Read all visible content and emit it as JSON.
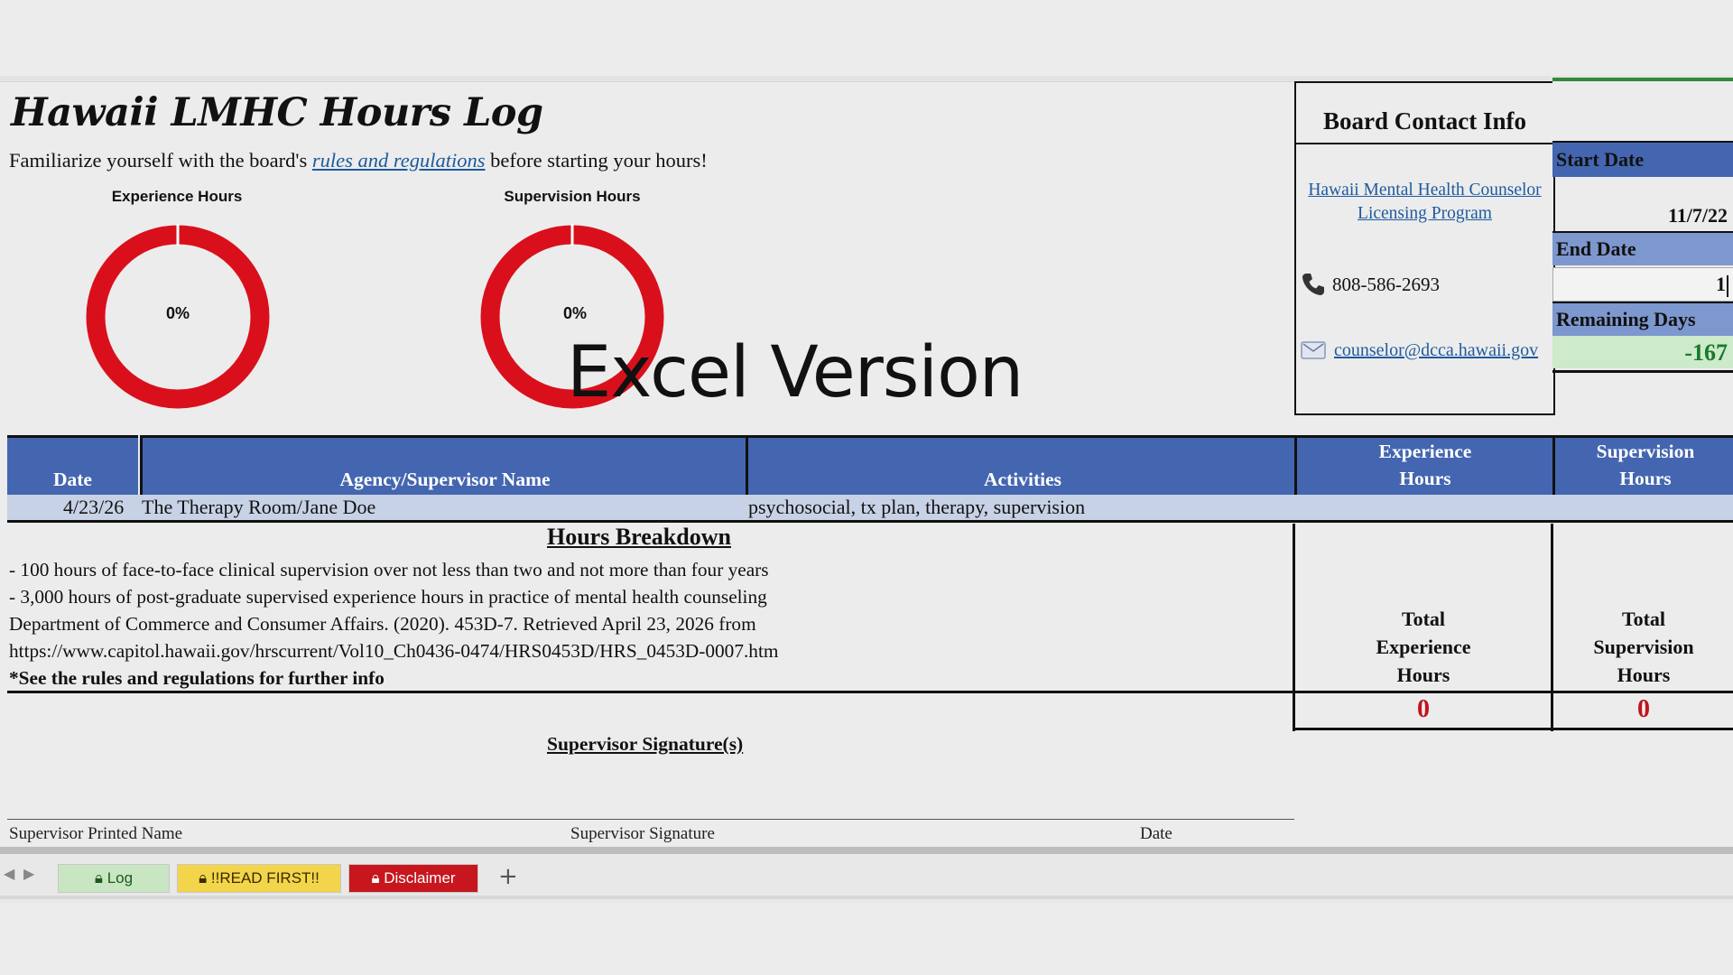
{
  "title": "Hawaii LMHC Hours Log",
  "subtitle": {
    "before": "Familiarize yourself with the board's ",
    "link": "rules and regulations",
    "after": " before starting your hours!"
  },
  "charts": {
    "experience": {
      "title": "Experience Hours",
      "label": "0%",
      "progress": 0,
      "color": "#d9101c"
    },
    "supervision": {
      "title": "Supervision Hours",
      "label": "0%",
      "progress": 0,
      "color": "#d9101c"
    }
  },
  "watermark": "Excel Version",
  "contact": {
    "title": "Board Contact Info",
    "program_link": "Hawaii Mental Health Counselor Licensing Program",
    "phone": "808-586-2693",
    "email": "counselor@dcca.hawaii.gov",
    "phone_icon": "phone-icon",
    "email_icon": "email-icon"
  },
  "dates": {
    "start_label": "Start Date",
    "start_value": "11/7/22",
    "end_label": "End Date",
    "end_value": "1",
    "remaining_label": "Remaining Days",
    "remaining_value": "-167",
    "remaining_color": "#1a7a2a",
    "remaining_bg": "#cdeacb"
  },
  "table": {
    "headers": {
      "date": "Date",
      "agency": "Agency/Supervisor Name",
      "activities": "Activities",
      "experience_1": "Experience",
      "experience_2": "Hours",
      "supervision_1": "Supervision",
      "supervision_2": "Hours"
    },
    "rows": [
      {
        "date": "4/23/26",
        "agency": "The Therapy Room/Jane Doe",
        "activities": "psychosocial, tx plan, therapy, supervision",
        "experience": "",
        "supervision": ""
      }
    ],
    "header_color": "#4466b0"
  },
  "breakdown": {
    "title": "Hours Breakdown",
    "lines": [
      "- 100 hours of face-to-face clinical supervision over not less than two and not more than four years",
      "- 3,000 hours of post-graduate supervised experience hours in practice of mental health counseling",
      "Department of Commerce and Consumer Affairs. (2020). 453D-7. Retrieved April 23, 2026 from",
      "https://www.capitol.hawaii.gov/hrscurrent/Vol10_Ch0436-0474/HRS0453D/HRS_0453D-0007.htm"
    ],
    "note": "*See the rules and regulations for further info"
  },
  "totals": {
    "experience_1": "Total",
    "experience_2": "Experience",
    "experience_3": "Hours",
    "supervision_1": "Total",
    "supervision_2": "Supervision",
    "supervision_3": "Hours",
    "experience_value": "0",
    "supervision_value": "0"
  },
  "signature": {
    "title": "Supervisor Signature(s)",
    "printed_name": "Supervisor Printed Name",
    "signature": "Supervisor Signature",
    "date": "Date"
  },
  "sheet_tabs": [
    {
      "label": "Log",
      "icon": "lock-icon",
      "bg": "#c9e6c2",
      "color": "#1c5a1c"
    },
    {
      "label": "!!READ FIRST!!",
      "icon": "lock-icon",
      "bg": "#f2d54a",
      "color": "#3a2a00"
    },
    {
      "label": "Disclaimer",
      "icon": "lock-icon",
      "bg": "#c7161e",
      "color": "#ffffff"
    }
  ],
  "add_sheet": "+"
}
